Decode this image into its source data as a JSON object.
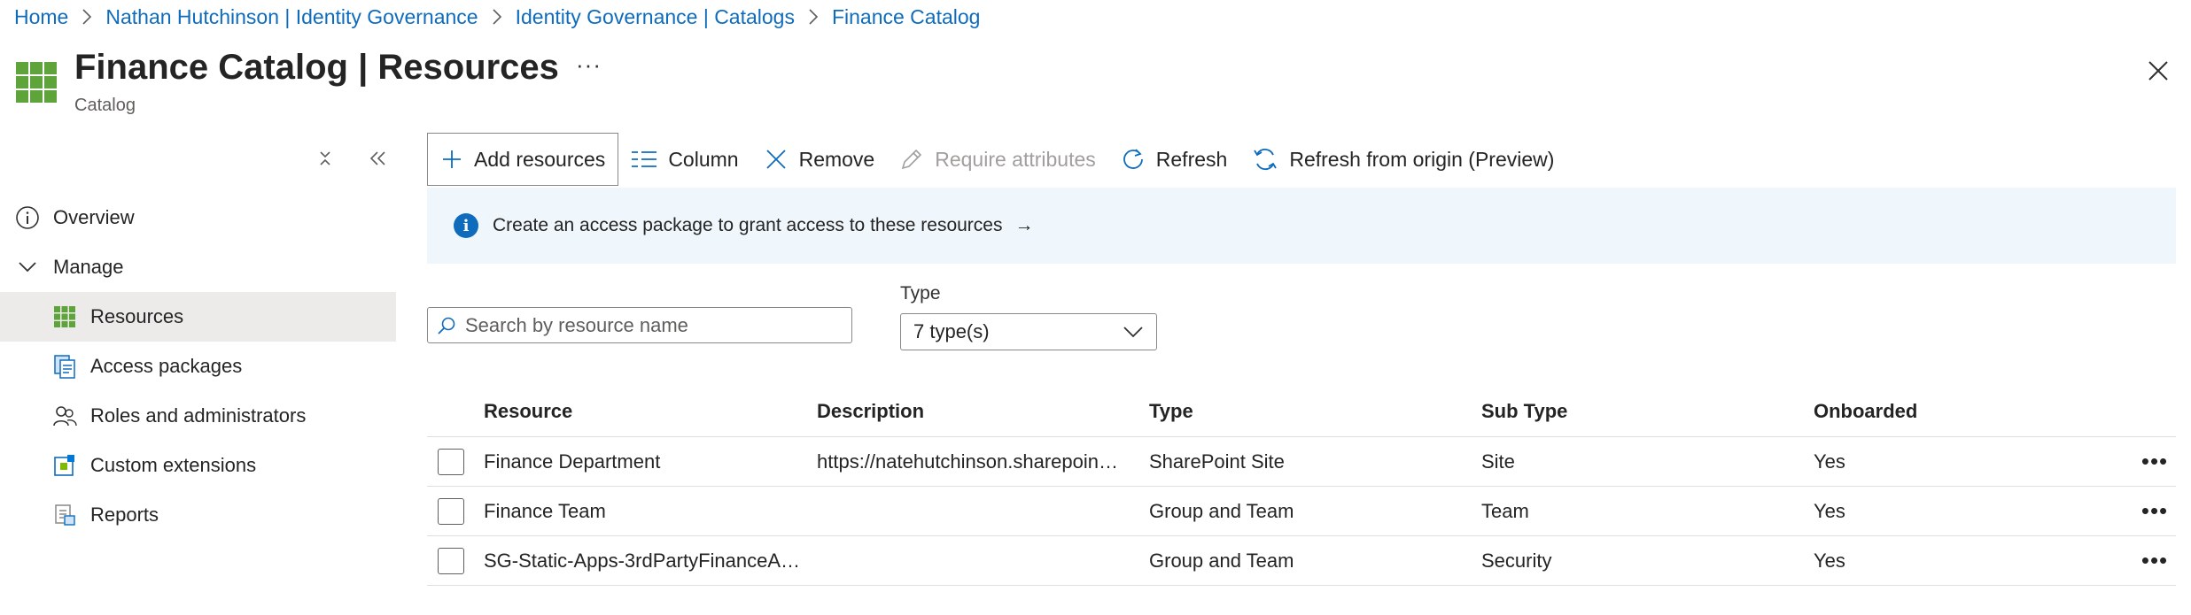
{
  "breadcrumb": {
    "items": [
      "Home",
      "Nathan Hutchinson | Identity Governance",
      "Identity Governance | Catalogs",
      "Finance Catalog"
    ]
  },
  "header": {
    "title_bold": "Finance Catalog",
    "title_rest": " | Resources",
    "subtitle": "Catalog",
    "more": "···"
  },
  "sidebar": {
    "items": [
      {
        "label": "Overview",
        "icon": "info-icon"
      },
      {
        "label": "Manage",
        "icon": "chevron-down-icon"
      },
      {
        "label": "Resources",
        "icon": "grid-icon",
        "active": true
      },
      {
        "label": "Access packages",
        "icon": "package-icon"
      },
      {
        "label": "Roles and administrators",
        "icon": "people-icon"
      },
      {
        "label": "Custom extensions",
        "icon": "extension-icon"
      },
      {
        "label": "Reports",
        "icon": "report-icon"
      }
    ]
  },
  "toolbar": {
    "add_resources": "Add resources",
    "column": "Column",
    "remove": "Remove",
    "require_attributes": "Require attributes",
    "refresh": "Refresh",
    "refresh_origin": "Refresh from origin (Preview)"
  },
  "info_bar": {
    "text": "Create an access package to grant access to these resources",
    "icon_glyph": "i",
    "arrow": "→"
  },
  "search": {
    "placeholder": "Search by resource name",
    "value": ""
  },
  "filter": {
    "label": "Type",
    "selected": "7 type(s)"
  },
  "table": {
    "columns": [
      "Resource",
      "Description",
      "Type",
      "Sub Type",
      "Onboarded"
    ],
    "rows": [
      {
        "resource": "Finance Department",
        "description": "https://natehutchinson.sharepoin…",
        "type": "SharePoint Site",
        "subtype": "Site",
        "onboarded": "Yes"
      },
      {
        "resource": "Finance Team",
        "description": "",
        "type": "Group and Team",
        "subtype": "Team",
        "onboarded": "Yes"
      },
      {
        "resource": "SG-Static-Apps-3rdPartyFinanceA…",
        "description": "",
        "type": "Group and Team",
        "subtype": "Security",
        "onboarded": "Yes"
      }
    ],
    "row_more": "•••"
  },
  "colors": {
    "link": "#0f6cbd",
    "accent_green": "#5ea43a",
    "info_bg": "#eff6fc",
    "active_bg": "#edebe9"
  }
}
